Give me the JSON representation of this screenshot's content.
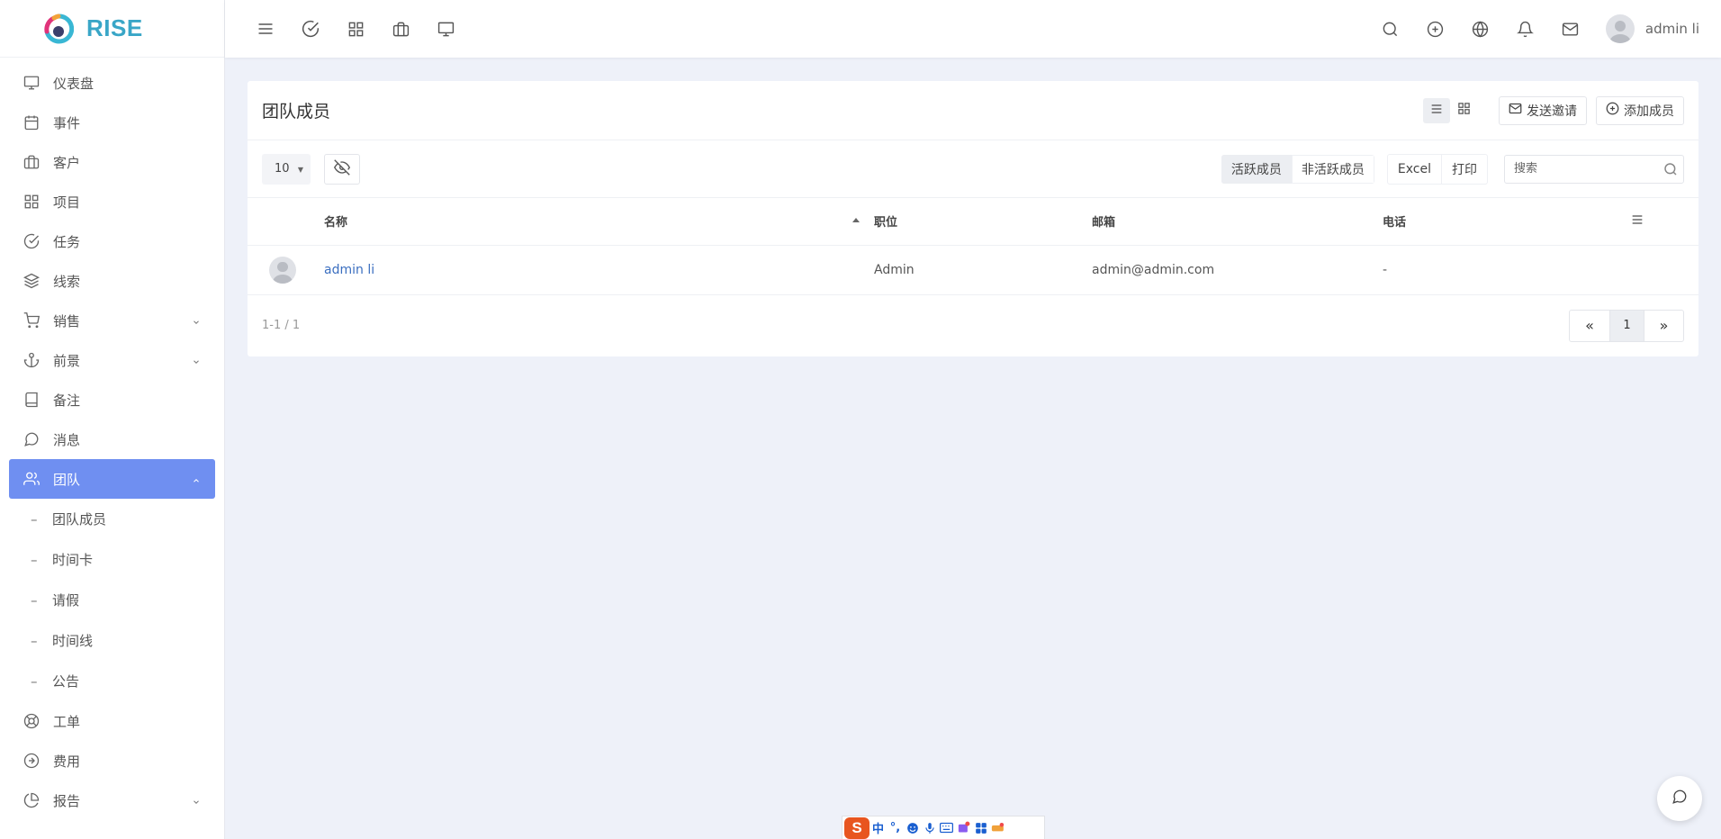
{
  "brand": {
    "name": "RISE"
  },
  "sidebar": {
    "items": [
      {
        "key": "dashboard",
        "label": "仪表盘",
        "icon": "monitor-icon"
      },
      {
        "key": "events",
        "label": "事件",
        "icon": "calendar-icon"
      },
      {
        "key": "clients",
        "label": "客户",
        "icon": "briefcase-icon"
      },
      {
        "key": "projects",
        "label": "项目",
        "icon": "grid-icon"
      },
      {
        "key": "tasks",
        "label": "任务",
        "icon": "check-circle-icon"
      },
      {
        "key": "leads",
        "label": "线索",
        "icon": "layers-icon"
      },
      {
        "key": "sales",
        "label": "销售",
        "icon": "cart-icon",
        "expandable": true
      },
      {
        "key": "prospects",
        "label": "前景",
        "icon": "anchor-icon",
        "expandable": true
      },
      {
        "key": "notes",
        "label": "备注",
        "icon": "book-icon"
      },
      {
        "key": "messages",
        "label": "消息",
        "icon": "message-icon"
      },
      {
        "key": "team",
        "label": "团队",
        "icon": "users-icon",
        "expandable": true,
        "active": true
      }
    ],
    "team_sub": [
      {
        "label": "团队成员"
      },
      {
        "label": "时间卡"
      },
      {
        "label": "请假"
      },
      {
        "label": "时间线"
      },
      {
        "label": "公告"
      }
    ],
    "bottom_items": [
      {
        "key": "tickets",
        "label": "工单",
        "icon": "lifebuoy-icon"
      },
      {
        "key": "expenses",
        "label": "费用",
        "icon": "arrow-circle-icon"
      },
      {
        "key": "reports",
        "label": "报告",
        "icon": "pie-chart-icon",
        "expandable": true
      }
    ]
  },
  "topbar": {
    "username": "admin li"
  },
  "card": {
    "title": "团队成员",
    "send_invite": "发送邀请",
    "add_member": "添加成员"
  },
  "toolbar": {
    "page_size": "10",
    "active_members": "活跃成员",
    "inactive_members": "非活跃成员",
    "excel": "Excel",
    "print": "打印",
    "search_placeholder": "搜索"
  },
  "table": {
    "columns": [
      "名称",
      "职位",
      "邮箱",
      "电话"
    ],
    "rows": [
      {
        "name": "admin li",
        "position": "Admin",
        "email": "admin@admin.com",
        "phone": "-"
      }
    ]
  },
  "footer": {
    "summary": "1-1 / 1",
    "prev": "«",
    "page": "1",
    "next": "»"
  },
  "ime": {
    "logo": "S",
    "lang": "中",
    "punct": "°,"
  },
  "colors": {
    "accent": "#6f8ff1",
    "brand": "#39a6c7",
    "link": "#3b6fc0",
    "background": "#eef1f9"
  }
}
